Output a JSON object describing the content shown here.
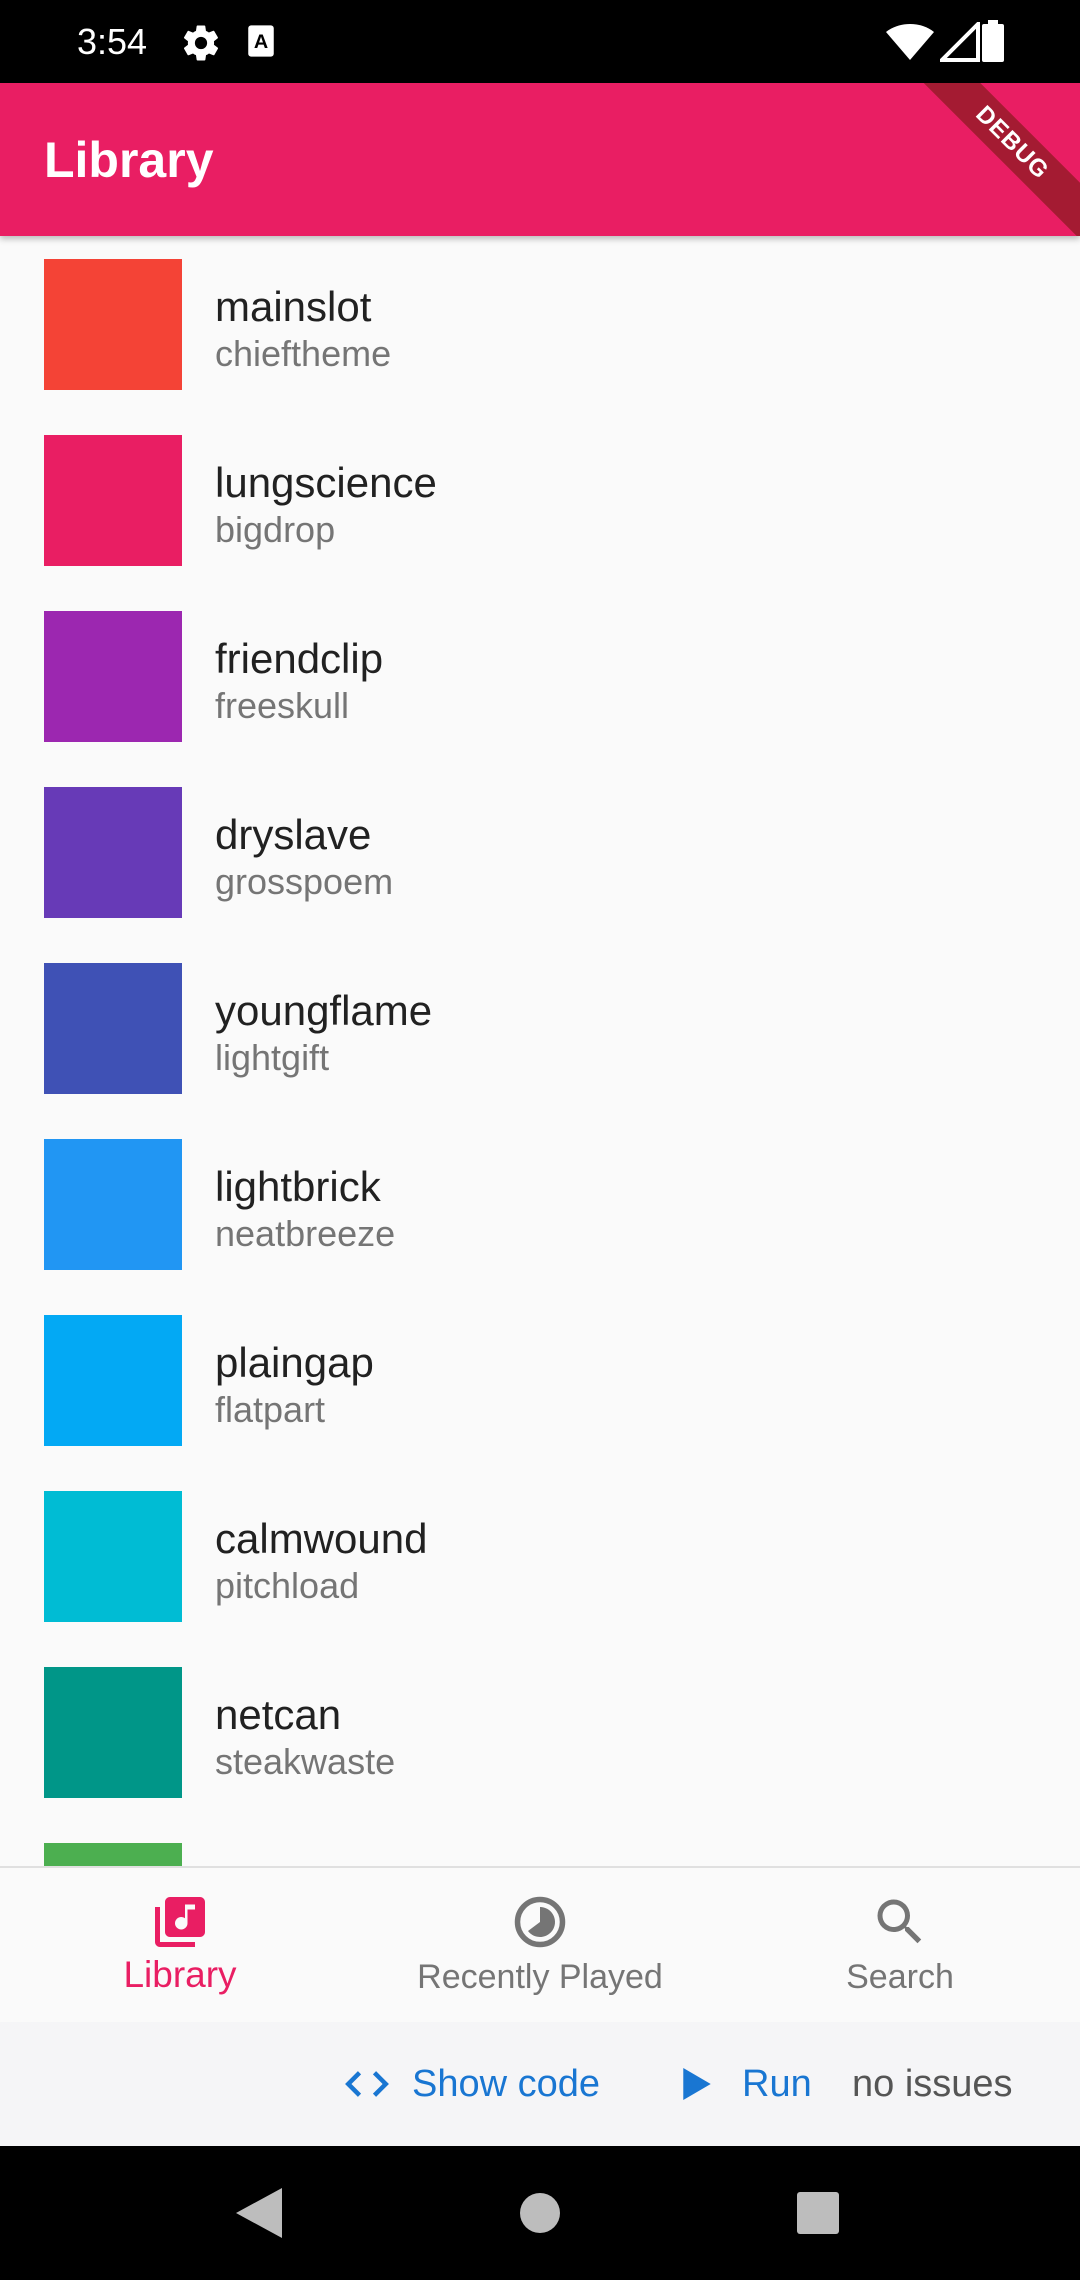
{
  "status_bar": {
    "time": "3:54",
    "icons": [
      "gear-icon",
      "a-notification-icon",
      "wifi-icon",
      "signal-icon",
      "battery-icon"
    ]
  },
  "app_bar": {
    "title": "Library",
    "debug_label": "DEBUG",
    "color": "#e91e63"
  },
  "library": {
    "items": [
      {
        "title": "mainslot",
        "subtitle": "chieftheme",
        "color": "#f44336"
      },
      {
        "title": "lungscience",
        "subtitle": "bigdrop",
        "color": "#e91e63"
      },
      {
        "title": "friendclip",
        "subtitle": "freeskull",
        "color": "#9c27b0"
      },
      {
        "title": "dryslave",
        "subtitle": "grosspoem",
        "color": "#673ab7"
      },
      {
        "title": "youngflame",
        "subtitle": "lightgift",
        "color": "#3f51b5"
      },
      {
        "title": "lightbrick",
        "subtitle": "neatbreeze",
        "color": "#2196f3"
      },
      {
        "title": "plaingap",
        "subtitle": "flatpart",
        "color": "#03a9f4"
      },
      {
        "title": "calmwound",
        "subtitle": "pitchload",
        "color": "#00bcd4"
      },
      {
        "title": "netcan",
        "subtitle": "steakwaste",
        "color": "#009688"
      },
      {
        "title": "",
        "subtitle": "",
        "color": "#4caf50"
      }
    ]
  },
  "bottom_nav": {
    "items": [
      {
        "label": "Library",
        "icon": "library-music-icon",
        "active": true
      },
      {
        "label": "Recently Played",
        "icon": "recent-icon",
        "active": false
      },
      {
        "label": "Search",
        "icon": "search-icon",
        "active": false
      }
    ],
    "active_color": "#e91e63"
  },
  "dev_bar": {
    "show_code_label": "Show code",
    "run_label": "Run",
    "status": "no issues",
    "link_color": "#1976d2"
  },
  "android_nav": {
    "icons": [
      "back-icon",
      "home-icon",
      "recents-icon"
    ]
  }
}
